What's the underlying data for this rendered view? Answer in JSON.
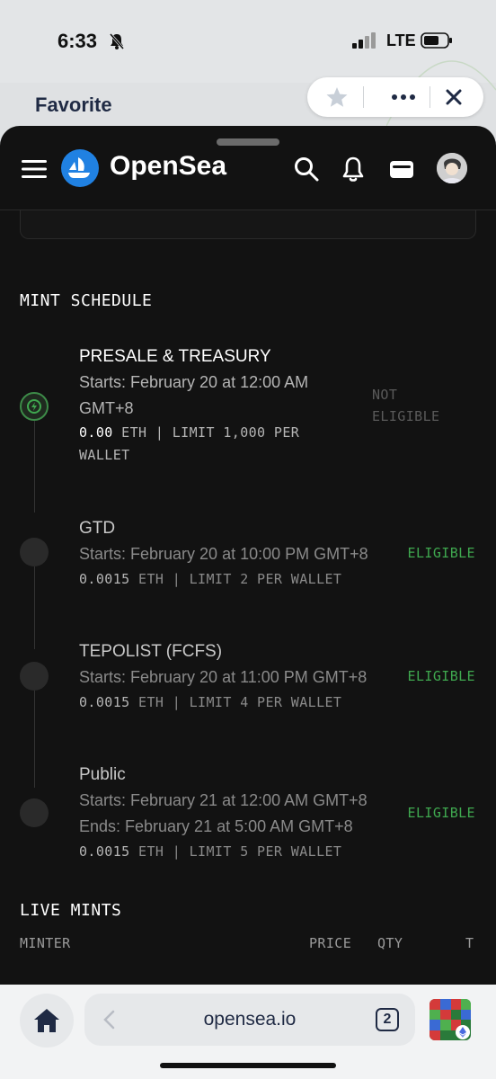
{
  "status_bar": {
    "time": "6:33",
    "network": "LTE"
  },
  "browser": {
    "tab_label": "Favorite",
    "url": "opensea.io",
    "tab_count": "2"
  },
  "nav": {
    "brand": "OpenSea"
  },
  "mint_schedule": {
    "title": "MINT SCHEDULE",
    "stages": [
      {
        "name": "PRESALE & TREASURY",
        "lines": [
          "Starts: February 20 at 12:00 AM",
          "GMT+8"
        ],
        "price": "0.00",
        "price_rest": " ETH | LIMIT 1,000 PER",
        "price_rest2": "WALLET",
        "status": [
          "NOT",
          "ELIGIBLE"
        ]
      },
      {
        "name": "GTD",
        "lines": [
          "Starts: February 20 at 10:00 PM GMT+8"
        ],
        "price": "0.0015",
        "price_rest": " ETH | LIMIT 2 PER WALLET",
        "status": [
          "ELIGIBLE"
        ]
      },
      {
        "name": "TEPOLIST (FCFS)",
        "lines": [
          "Starts: February 20 at 11:00 PM GMT+8"
        ],
        "price": "0.0015",
        "price_rest": " ETH | LIMIT 4 PER WALLET",
        "status": [
          "ELIGIBLE"
        ]
      },
      {
        "name": "Public",
        "lines": [
          "Starts: February 21 at 12:00 AM GMT+8",
          "Ends: February 21 at 5:00 AM GMT+8"
        ],
        "price": "0.0015",
        "price_rest": " ETH | LIMIT 5 PER WALLET",
        "status": [
          "ELIGIBLE"
        ]
      }
    ]
  },
  "live_mints": {
    "title": "LIVE MINTS",
    "columns": [
      "MINTER",
      "PRICE",
      "QTY",
      "T"
    ]
  },
  "colors": {
    "sheet_bg": "#121212",
    "eligible_green": "#3fa84f",
    "not_eligible_gray": "#5a5a5a",
    "opensea_blue": "#2081e2"
  }
}
